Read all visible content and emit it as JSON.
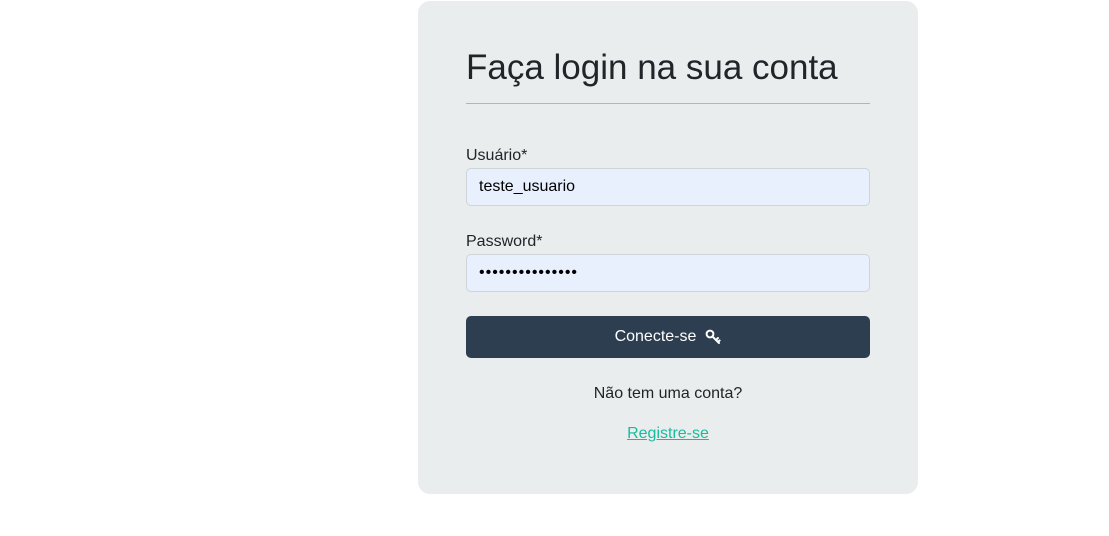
{
  "login": {
    "title": "Faça login na sua conta",
    "username_label": "Usuário*",
    "username_value": "teste_usuario",
    "password_label": "Password*",
    "password_value": "•••••••••••••••",
    "submit_label": "Conecte-se",
    "submit_icon": "key-icon",
    "no_account_text": "Não tem uma conta?",
    "register_link": "Registre-se"
  },
  "colors": {
    "card_bg": "#e9edee",
    "input_bg": "#e8f0fe",
    "button_bg": "#2c3e50",
    "link": "#18bc9c"
  }
}
